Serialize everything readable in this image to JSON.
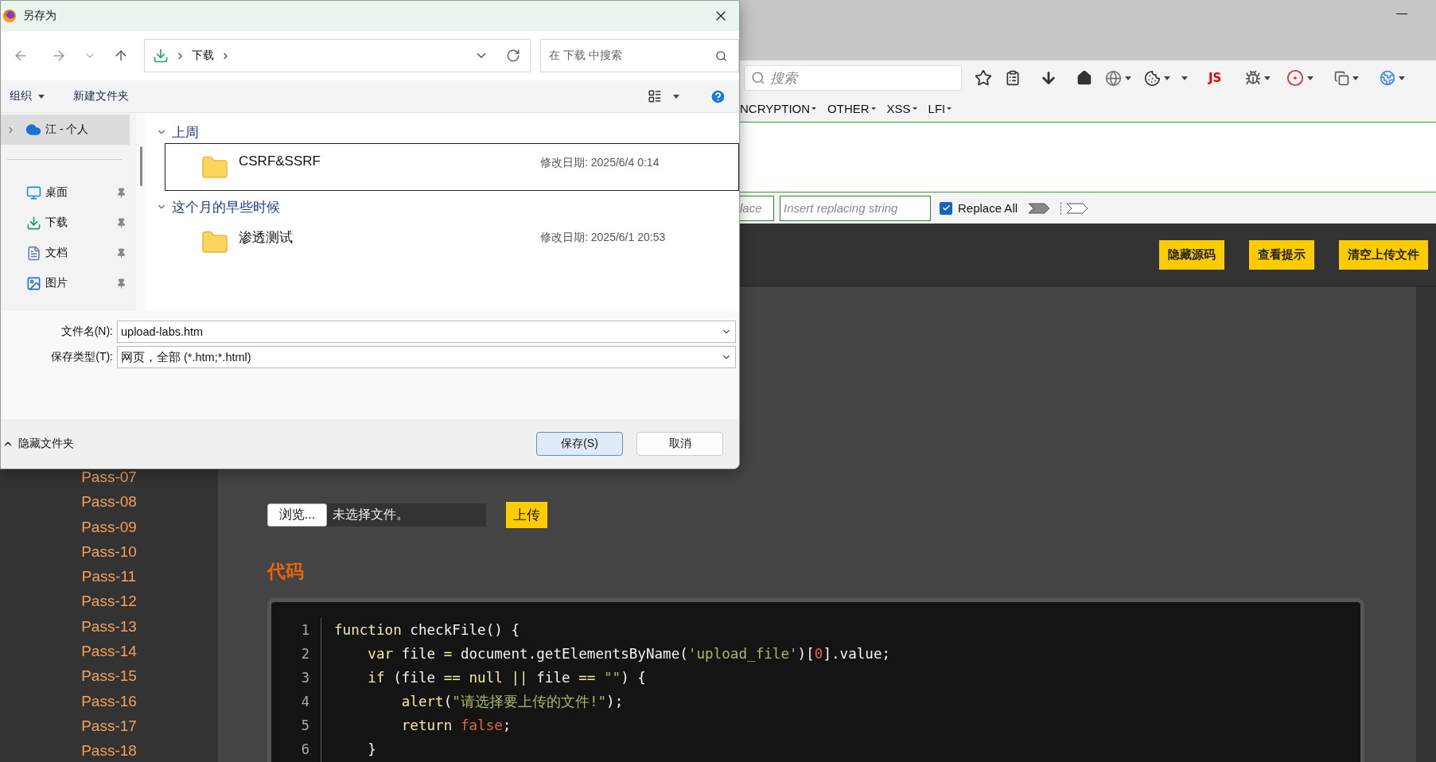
{
  "browser": {
    "search_placeholder": "搜索",
    "js_label": "JS",
    "menu": [
      "NCRYPTION",
      "OTHER",
      "XSS",
      "LFI"
    ],
    "replace_bar": {
      "find_placeholder": "lace",
      "replace_placeholder": "Insert replacing string",
      "replace_all": {
        "label": "Replace All",
        "checked": true
      }
    },
    "header_buttons": [
      "隐藏源码",
      "查看提示",
      "清空上传文件"
    ]
  },
  "sidebar": {
    "items": [
      "Pass-07",
      "Pass-08",
      "Pass-09",
      "Pass-10",
      "Pass-11",
      "Pass-12",
      "Pass-13",
      "Pass-14",
      "Pass-15",
      "Pass-16",
      "Pass-17",
      "Pass-18"
    ]
  },
  "upload": {
    "browse": "浏览...",
    "file_status": "未选择文件。",
    "submit": "上传"
  },
  "code": {
    "heading": "代码",
    "lines": [
      {
        "number": "1",
        "tokens": [
          {
            "kind": "kw",
            "text": "function"
          },
          {
            "kind": "plain",
            "text": " checkFile() {"
          }
        ]
      },
      {
        "number": "2",
        "tokens": [
          {
            "kind": "kw",
            "text": "    var"
          },
          {
            "kind": "plain",
            "text": " file "
          },
          {
            "kind": "kw",
            "text": "="
          },
          {
            "kind": "plain",
            "text": " document.getElementsByName("
          },
          {
            "kind": "str",
            "text": "'upload_file'"
          },
          {
            "kind": "plain",
            "text": ")["
          },
          {
            "kind": "lit",
            "text": "0"
          },
          {
            "kind": "plain",
            "text": "].value;"
          }
        ]
      },
      {
        "number": "3",
        "tokens": [
          {
            "kind": "kw",
            "text": "    if"
          },
          {
            "kind": "plain",
            "text": " (file "
          },
          {
            "kind": "kw",
            "text": "== null ||"
          },
          {
            "kind": "plain",
            "text": " file "
          },
          {
            "kind": "kw",
            "text": "=="
          },
          {
            "kind": "str",
            "text": " \"\""
          },
          {
            "kind": "plain",
            "text": ") {"
          }
        ]
      },
      {
        "number": "4",
        "tokens": [
          {
            "kind": "kw",
            "text": "        alert"
          },
          {
            "kind": "plain",
            "text": "("
          },
          {
            "kind": "str",
            "text": "\"请选择要上传的文件!\""
          },
          {
            "kind": "plain",
            "text": ");"
          }
        ]
      },
      {
        "number": "5",
        "tokens": [
          {
            "kind": "kw",
            "text": "        return"
          },
          {
            "kind": "lit",
            "text": " false"
          },
          {
            "kind": "plain",
            "text": ";"
          }
        ]
      },
      {
        "number": "6",
        "tokens": [
          {
            "kind": "plain",
            "text": "    }"
          }
        ]
      }
    ]
  },
  "dialog": {
    "title": "另存为",
    "path": [
      "下载"
    ],
    "search_placeholder": "在 下载 中搜索",
    "commands": [
      "组织",
      "新建文件夹"
    ],
    "nav": [
      {
        "label": "江 - 个人",
        "kind": "cloud",
        "selected": true,
        "pinned": false
      },
      {
        "label": "桌面",
        "kind": "desktop",
        "selected": false,
        "pinned": true
      },
      {
        "label": "下载",
        "kind": "download",
        "selected": false,
        "pinned": true
      },
      {
        "label": "文档",
        "kind": "docs",
        "selected": false,
        "pinned": true
      },
      {
        "label": "图片",
        "kind": "pictures",
        "selected": false,
        "pinned": true
      }
    ],
    "groups": [
      {
        "label": "上周",
        "expanded": true,
        "items": [
          {
            "name": "CSRF&SSRF",
            "modified": "修改日期: 2025/6/4 0:14",
            "selected": true
          }
        ]
      },
      {
        "label": "这个月的早些时候",
        "expanded": true,
        "items": [
          {
            "name": "渗透测试",
            "modified": "修改日期: 2025/6/1 20:53",
            "selected": false
          }
        ]
      }
    ],
    "filename": {
      "label": "文件名(N):",
      "value": "upload-labs.htm"
    },
    "filetype": {
      "label": "保存类型(T):",
      "value": "网页，全部 (*.htm;*.html)"
    },
    "hide_folders": "隐藏文件夹",
    "buttons": [
      {
        "label": "保存(S)",
        "primary": true
      },
      {
        "label": "取消",
        "primary": false
      }
    ]
  }
}
